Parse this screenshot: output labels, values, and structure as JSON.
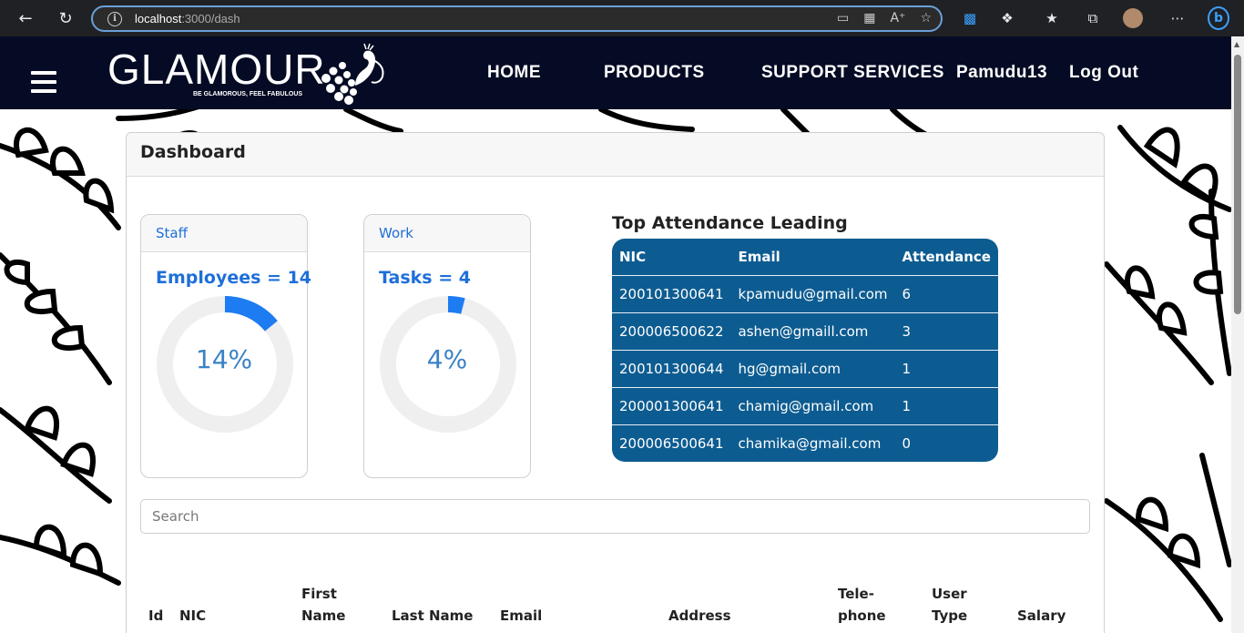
{
  "browser": {
    "url_host": "localhost",
    "url_path": ":3000/dash"
  },
  "site": {
    "brand": "GLAMOUR",
    "tagline": "BE GLAMOROUS, FEEL FABULOUS",
    "nav": {
      "home": "HOME",
      "products": "PRODUCTS",
      "support": "SUPPORT SERVICES",
      "user": "Pamudu13",
      "logout": "Log Out"
    }
  },
  "dashboard": {
    "title": "Dashboard",
    "staff": {
      "header": "Staff",
      "label": "Employees = 14",
      "percent": "14%",
      "fraction": 0.14
    },
    "work": {
      "header": "Work",
      "label": "Tasks = 4",
      "percent": "4%",
      "fraction": 0.04
    },
    "attendance": {
      "title": "Top Attendance Leading",
      "columns": [
        "NIC",
        "Email",
        "Attendance"
      ],
      "rows": [
        [
          "200101300641",
          "kpamudu@gmail.com",
          "6"
        ],
        [
          "200006500622",
          "ashen@gmaill.com",
          "3"
        ],
        [
          "200101300644",
          "hg@gmail.com",
          "1"
        ],
        [
          "200001300641",
          "chamig@gmail.com",
          "1"
        ],
        [
          "200006500641",
          "chamika@gmail.com",
          "0"
        ]
      ]
    },
    "search_placeholder": "Search",
    "employee_columns": {
      "id": "Id",
      "nic": "NIC",
      "first_name_1": "First",
      "first_name_2": "Name",
      "last_name": "Last Name",
      "email": "Email",
      "address": "Address",
      "telephone_1": "Tele-",
      "telephone_2": "phone",
      "user_type_1": "User",
      "user_type_2": "Type",
      "salary": "Salary"
    }
  },
  "colors": {
    "header_bg": "#050b24",
    "accent_blue": "#1e6fd9",
    "table_bg": "#0d5c91"
  }
}
